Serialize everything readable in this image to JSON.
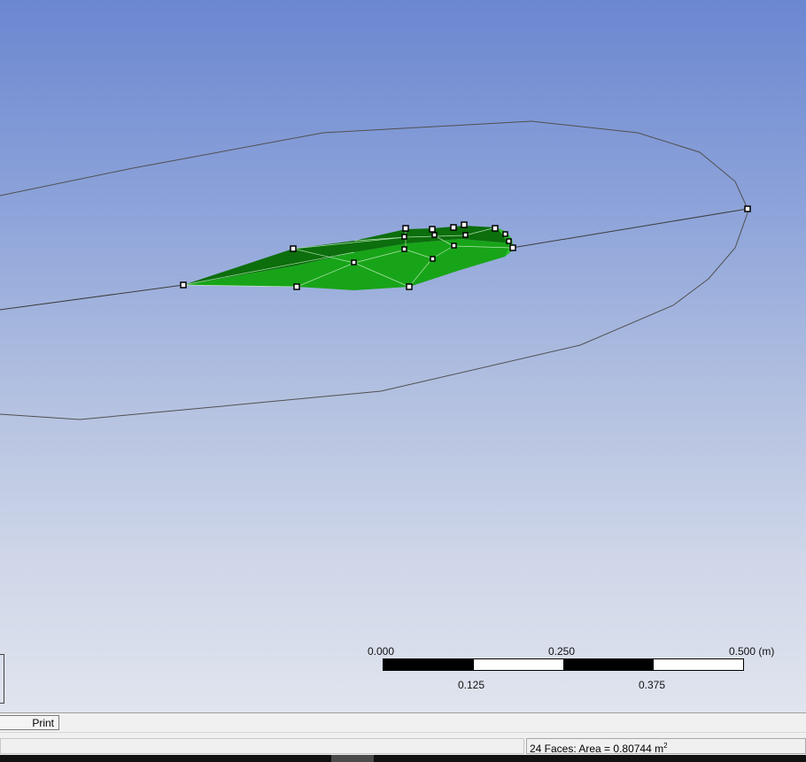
{
  "viewport": {
    "scale_ruler": {
      "top_labels": [
        "0.000",
        "0.250",
        "0.500 (m)"
      ],
      "bottom_labels": [
        "0.125",
        "0.375"
      ],
      "segments": [
        "dark",
        "light",
        "dark",
        "light"
      ]
    },
    "colors": {
      "background_top": "#6b87d0",
      "background_bottom": "#e0e4ee",
      "selected_face": "#16a316",
      "selected_face_dark": "#0a6b0a",
      "edge_line": "#3c3c3c"
    }
  },
  "tabs": {
    "print_preview": "Print Preview"
  },
  "status": {
    "selection_prefix": "24 Faces: Area = 0.80744 m",
    "selection_exponent": "2"
  }
}
